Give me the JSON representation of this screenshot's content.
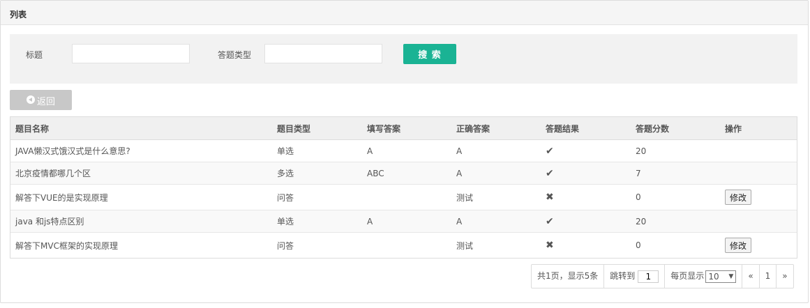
{
  "panel": {
    "title": "列表"
  },
  "search": {
    "title_label": "标题",
    "title_value": "",
    "type_label": "答题类型",
    "type_value": "",
    "search_button": "搜 索"
  },
  "back_button": "返回",
  "table": {
    "headers": [
      "题目名称",
      "题目类型",
      "填写答案",
      "正确答案",
      "答题结果",
      "答题分数",
      "操作"
    ],
    "rows": [
      {
        "name": "JAVA懒汉式饿汉式是什么意思?",
        "type": "单选",
        "answer": "A",
        "correct": "A",
        "result": "✔",
        "score": "20",
        "action": ""
      },
      {
        "name": "北京疫情都哪几个区",
        "type": "多选",
        "answer": "ABC",
        "correct": "A",
        "result": "✔",
        "score": "7",
        "action": ""
      },
      {
        "name": "解答下VUE的是实现原理",
        "type": "问答",
        "answer": "",
        "correct": "测试",
        "result": "✖",
        "score": "0",
        "action": "修改"
      },
      {
        "name": "java 和js特点区别",
        "type": "单选",
        "answer": "A",
        "correct": "A",
        "result": "✔",
        "score": "20",
        "action": ""
      },
      {
        "name": "解答下MVC框架的实现原理",
        "type": "问答",
        "answer": "",
        "correct": "测试",
        "result": "✖",
        "score": "0",
        "action": "修改"
      }
    ]
  },
  "pager": {
    "summary": "共1页，显示5条",
    "jump_label": "跳转到",
    "jump_value": "1",
    "per_page_label": "每页显示",
    "per_page_value": "10",
    "prev": "«",
    "page": "1",
    "next": "»"
  },
  "colors": {
    "accent": "#1ab394",
    "back_button": "#c8c8c8"
  }
}
